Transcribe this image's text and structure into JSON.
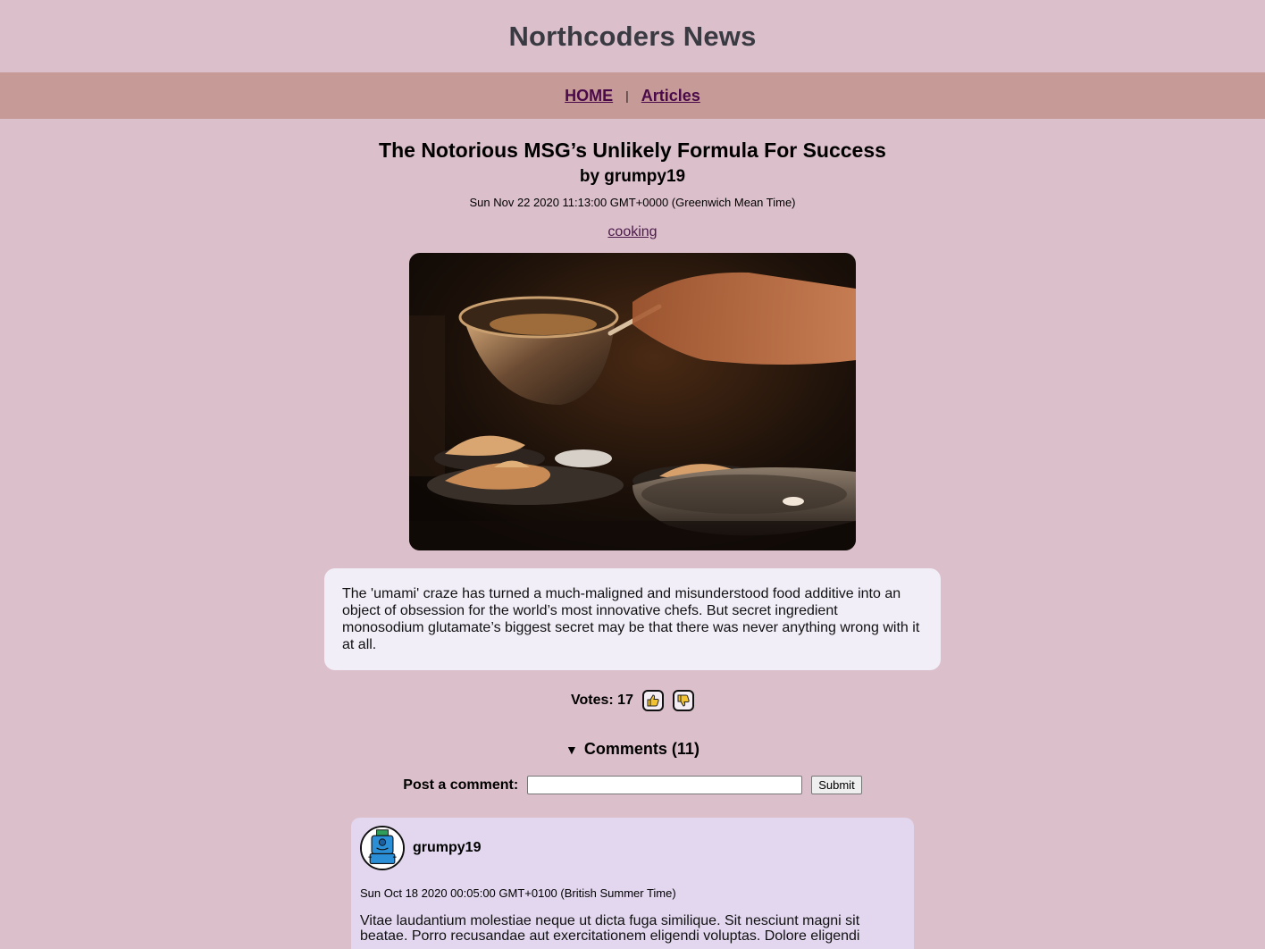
{
  "header": {
    "title": "Northcoders News"
  },
  "nav": {
    "home_label": "HOME",
    "separator": "|",
    "articles_label": "Articles"
  },
  "article": {
    "title": "The Notorious MSG’s Unlikely Formula For Success",
    "byline": "by grumpy19",
    "date": "Sun Nov 22 2020 11:13:00 GMT+0000 (Greenwich Mean Time)",
    "topic": "cooking",
    "body": "The 'umami' craze has turned a much-maligned and misunderstood food additive into an object of obsession for the world’s most innovative chefs. But secret ingredient monosodium glutamate’s biggest secret may be that there was never anything wrong with it at all."
  },
  "votes": {
    "label": "Votes: 17",
    "upvote_icon": "thumbs-up-icon",
    "downvote_icon": "thumbs-down-icon"
  },
  "comments": {
    "toggle_label": "Comments (11)",
    "post_label": "Post a comment:",
    "input_value": "",
    "submit_label": "Submit",
    "items": [
      {
        "author": "grumpy19",
        "date": "Sun Oct 18 2020 00:05:00 GMT+0100 (British Summer Time)",
        "body": "Vitae laudantium molestiae neque ut dicta fuga similique. Sit nesciunt magni sit beatae. Porro recusandae aut exercitationem eligendi voluptas. Dolore eligendi"
      }
    ]
  },
  "colors": {
    "page_bg": "#dbbfca",
    "nav_bg": "#c69a96",
    "link": "#4a0a4a",
    "article_body_bg": "#f1eef8",
    "comment_bg": "#e2d7ee"
  }
}
